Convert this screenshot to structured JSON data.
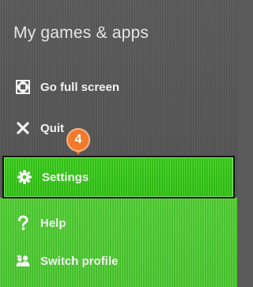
{
  "menu": {
    "title": "My games & apps",
    "items": [
      {
        "label": "Go full screen",
        "icon": "fullscreen-icon"
      },
      {
        "label": "Quit",
        "icon": "close-icon"
      },
      {
        "label": "Settings",
        "icon": "gear-icon",
        "selected": true
      },
      {
        "label": "Help",
        "icon": "question-icon"
      },
      {
        "label": "Switch profile",
        "icon": "switch-profile-icon"
      }
    ]
  },
  "callout": {
    "step": "4",
    "color": "#f07a2a"
  },
  "colors": {
    "menu_bg": "#5a5a5a",
    "selected_bg": "#3ed21c",
    "green_bg": "#52cf34",
    "text": "#f2f2f2"
  }
}
